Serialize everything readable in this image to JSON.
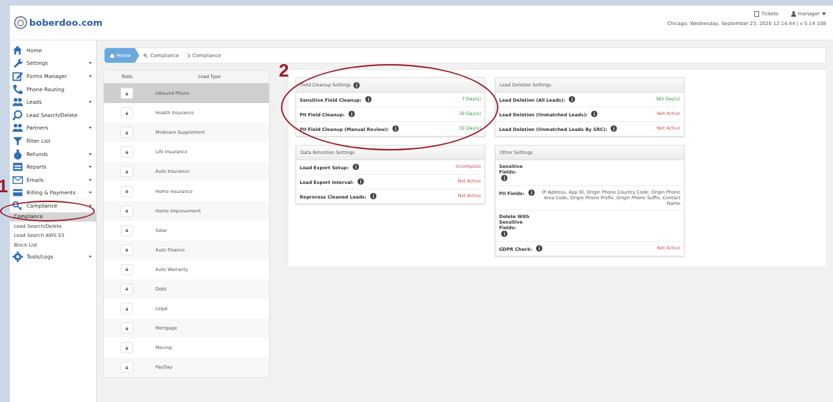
{
  "header": {
    "logo": "boberdoo.com",
    "tickets": "Tickets",
    "user": "manager",
    "clock": "Chicago: Wednesday, September 23, 2020 12:14:44 | v 5.14 108"
  },
  "sidebar": {
    "items": [
      {
        "label": "Home",
        "has_menu": false
      },
      {
        "label": "Settings",
        "has_menu": true,
        "expanded": false
      },
      {
        "label": "Forms Manager",
        "has_menu": true,
        "expanded": false
      },
      {
        "label": "Phone Routing",
        "has_menu": false
      },
      {
        "label": "Leads",
        "has_menu": true,
        "expanded": false
      },
      {
        "label": "Lead Search/Delete",
        "has_menu": false
      },
      {
        "label": "Partners",
        "has_menu": true,
        "expanded": false
      },
      {
        "label": "Filter List",
        "has_menu": false
      },
      {
        "label": "Refunds",
        "has_menu": true,
        "expanded": false
      },
      {
        "label": "Reports",
        "has_menu": true,
        "expanded": false
      },
      {
        "label": "Emails",
        "has_menu": true,
        "expanded": false
      },
      {
        "label": "Billing & Payments",
        "has_menu": true,
        "expanded": false
      },
      {
        "label": "Compliance",
        "has_menu": true,
        "expanded": true,
        "children": [
          {
            "label": "Compliance",
            "selected": true
          },
          {
            "label": "Lead Search/Delete",
            "selected": false
          },
          {
            "label": "Lead Search AWS S3",
            "selected": false
          },
          {
            "label": "Block List",
            "selected": false
          }
        ]
      },
      {
        "label": "Tools/Logs",
        "has_menu": true,
        "expanded": false
      }
    ]
  },
  "breadcrumb": [
    {
      "label": "Home",
      "kind": "home"
    },
    {
      "label": "Compliance",
      "kind": "section"
    },
    {
      "label": "Compliance",
      "kind": "page"
    }
  ],
  "lead_table": {
    "columns": [
      "Tools",
      "Lead Type"
    ],
    "rows": [
      {
        "lead_type": "Inbound Phone",
        "selected": true
      },
      {
        "lead_type": "Health Insurance",
        "selected": false
      },
      {
        "lead_type": "Medicare Supplement",
        "selected": false
      },
      {
        "lead_type": "Life Insurance",
        "selected": false
      },
      {
        "lead_type": "Auto Insurance",
        "selected": false
      },
      {
        "lead_type": "Home Insurance",
        "selected": false
      },
      {
        "lead_type": "Home Improvement",
        "selected": false
      },
      {
        "lead_type": "Solar",
        "selected": false
      },
      {
        "lead_type": "Auto Finance",
        "selected": false
      },
      {
        "lead_type": "Auto Warranty",
        "selected": false
      },
      {
        "lead_type": "Debt",
        "selected": false
      },
      {
        "lead_type": "Legal",
        "selected": false
      },
      {
        "lead_type": "Mortgage",
        "selected": false
      },
      {
        "lead_type": "Moving",
        "selected": false
      },
      {
        "lead_type": "PayDay",
        "selected": false
      }
    ]
  },
  "panels": [
    {
      "title": "Field Cleanup Settings",
      "title_info": true,
      "rows": [
        {
          "label": "Sensitive Field Cleanup:",
          "value": "7 Day(s)",
          "kind": "active"
        },
        {
          "label": "PII Field Cleanup:",
          "value": "30 Day(s)",
          "kind": "active"
        },
        {
          "label": "PII Field Cleanup (Manual Review):",
          "value": "30 Day(s)",
          "kind": "active"
        }
      ]
    },
    {
      "title": "Data Retention Settings",
      "title_info": false,
      "rows": [
        {
          "label": "Lead Export Setup:",
          "value": "Incomplete",
          "kind": "inactive"
        },
        {
          "label": "Lead Export Interval:",
          "value": "Not Active",
          "kind": "inactive"
        },
        {
          "label": "Reprocess Cleaned Leads:",
          "value": "Not Active",
          "kind": "inactive"
        }
      ]
    },
    {
      "title": "Lead Deletion Settings",
      "title_info": false,
      "rows": [
        {
          "label": "Lead Deletion (All Leads):",
          "value": "365 Day(s)",
          "kind": "active"
        },
        {
          "label": "Lead Deletion (Unmatched Leads):",
          "value": "Not Active",
          "kind": "inactive"
        },
        {
          "label": "Lead Deletion (Unmatched Leads By SRC):",
          "value": "Not Active",
          "kind": "inactive"
        }
      ]
    },
    {
      "title": "Other Settings",
      "title_info": false,
      "rows": [
        {
          "label": "Sensitive Fields:",
          "kind": "empty"
        },
        {
          "label": "PII Fields:",
          "value": "IP Address, App ID, Origin Phone Country Code, Origin Phone Area Code, Origin Phone Prefix, Origin Phone Suffix, Contact Name",
          "kind": "text"
        },
        {
          "label": "Delete With Sensitive Fields:",
          "kind": "empty"
        },
        {
          "label": "GDPR Check:",
          "value": "Not Active",
          "kind": "inactive"
        }
      ]
    }
  ],
  "annotations": [
    {
      "label": "1"
    },
    {
      "label": "2"
    }
  ]
}
